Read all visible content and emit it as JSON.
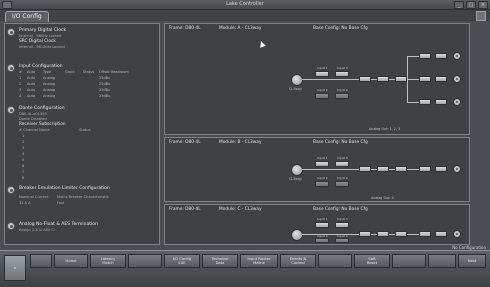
{
  "app": {
    "title": "Lake Controller"
  },
  "tab": {
    "label": "I/O Config"
  },
  "left": {
    "clock": {
      "title": "Primary Digital Clock",
      "line1": "Internal - 96kHz Locked",
      "line2": "SRC Digital Clock",
      "line3": "Internal - 96.0kHz Locked"
    },
    "inputs": {
      "title": "Input Configuration",
      "headers": [
        "#",
        "Auto",
        "Type",
        "Clock",
        "Status",
        "Offset Headroom"
      ],
      "rows": [
        [
          "1",
          "Auto",
          "Analog",
          "",
          "",
          "25dBu"
        ],
        [
          "2",
          "Auto",
          "Analog",
          "",
          "",
          "25dBu"
        ],
        [
          "3",
          "Auto",
          "Analog",
          "",
          "",
          "25dBu"
        ],
        [
          "4",
          "Auto",
          "Analog",
          "",
          "",
          "25dBu"
        ]
      ]
    },
    "dante": {
      "title": "Dante Configuration",
      "line1": "D80-4L-a01393",
      "line2": "Dante Disabled",
      "subtitle": "Receiver Subscription",
      "col1": "#  Channel Name",
      "col2": "Status",
      "rows": [
        "1",
        "2",
        "3",
        "4",
        "5",
        "6",
        "7",
        "8"
      ]
    },
    "breaker": {
      "title": "Breaker Emulation Limiter Configuration",
      "col1": "Nominal Current",
      "col2": "Mains Breaker Characteristic",
      "val1": "32.0 A",
      "val2": "Fast"
    },
    "aes": {
      "title": "Analog No-Float & AES Termination",
      "line": "Assign 1-4    ☑      AES    ☐"
    }
  },
  "frames": [
    {
      "frame": "Frame: D80-4L",
      "module": "Module: A - CL3way",
      "base": "Base Config: No Base Cfg",
      "knob_label": "CL3way",
      "footer": "Analog Out: 1, 2, 3",
      "inputs": [
        "Input 1",
        "Input 2",
        "Input 3",
        "Input 4"
      ]
    },
    {
      "frame": "Frame: D80-4L",
      "module": "Module: B - CL3way",
      "base": "Base Config: No Base Cfg",
      "knob_label": "CL3way",
      "footer": "Analog Out: 4",
      "inputs": [
        "Input 1",
        "Input 2",
        "Input 3",
        "Input 4"
      ]
    },
    {
      "frame": "Frame: D80-4L",
      "module": "Module: C - CL3way",
      "base": "Base Config: No Base Cfg",
      "knob_label": "",
      "footer": "",
      "inputs": [
        "Input 1",
        "Input 2",
        "Input 3",
        "Input 4"
      ]
    }
  ],
  "status": "No Configuration",
  "bottom": {
    "buttons": [
      "",
      "",
      "Home",
      "Latency\nMatch",
      "",
      "I/O Config\nEXE",
      "Technical\nData",
      "Input Router\nMatrix",
      "Events &\nControl",
      "",
      "Soft\nReset",
      "",
      "",
      "Next"
    ]
  },
  "colors": {
    "panel": "#3e4245",
    "border": "#7d8387",
    "accent": "#d9dde0"
  }
}
